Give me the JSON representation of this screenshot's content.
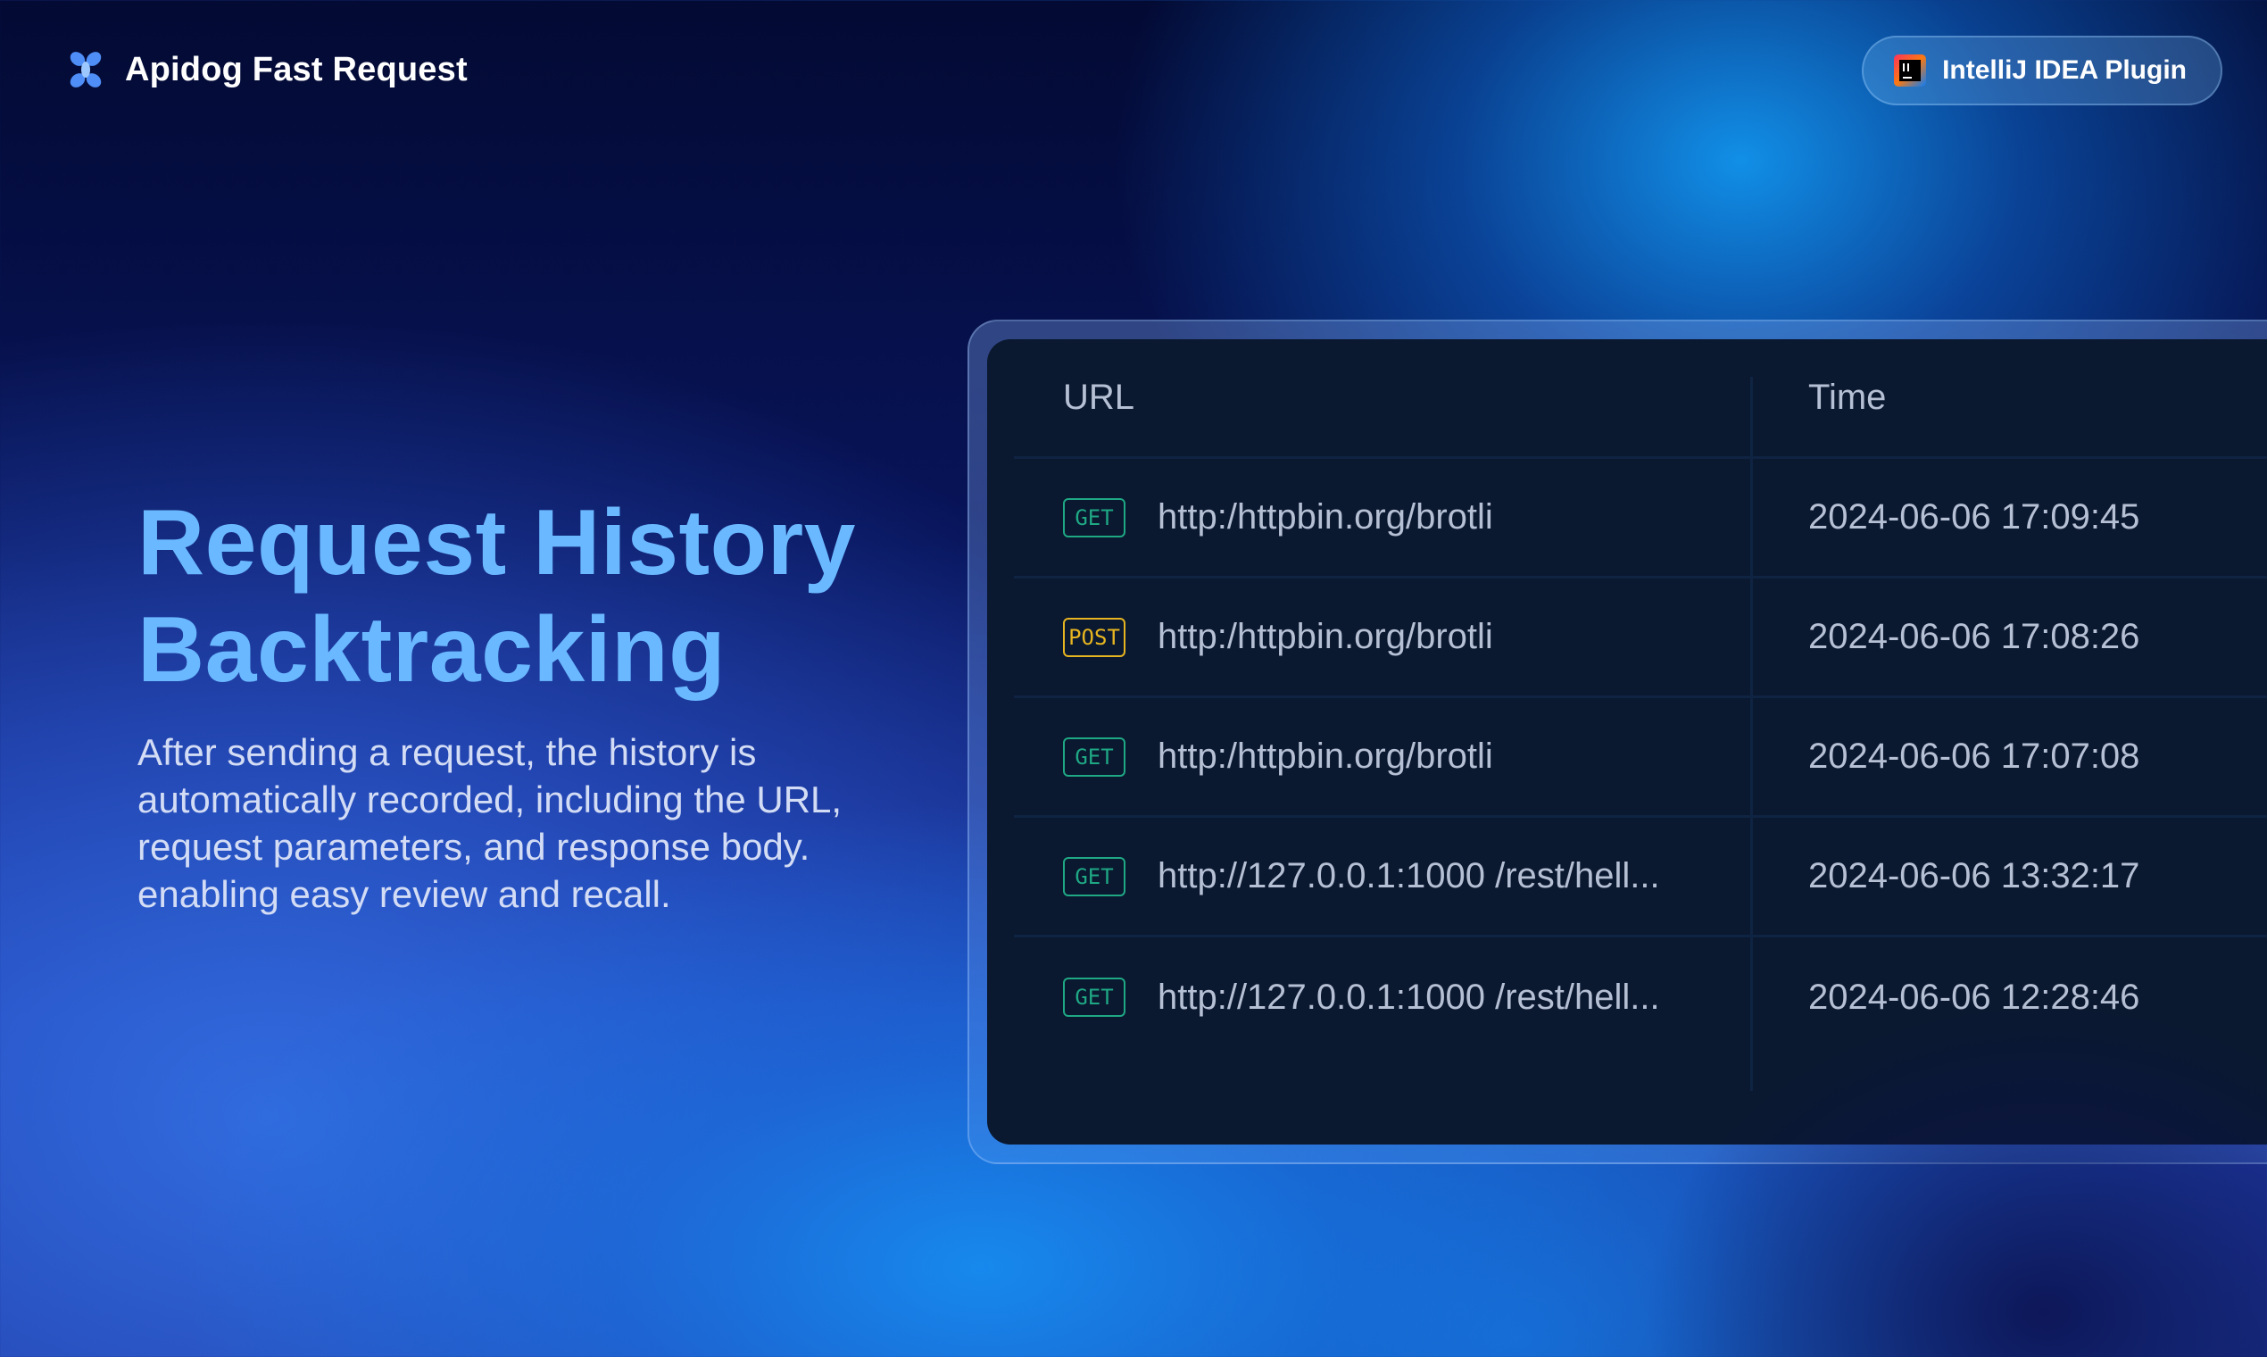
{
  "header": {
    "brand_name": "Apidog Fast Request",
    "plugin_label": "IntelliJ IDEA Plugin"
  },
  "hero": {
    "title_line1": "Request History",
    "title_line2": "Backtracking",
    "description": "After sending a request, the history is automatically recorded, including the URL, request parameters, and response body. enabling easy review and recall."
  },
  "table": {
    "columns": [
      "URL",
      "Time"
    ],
    "rows": [
      {
        "method": "GET",
        "url": "http:/httpbin.org/brotli",
        "time": "2024-06-06 17:09:45"
      },
      {
        "method": "POST",
        "url": "http:/httpbin.org/brotli",
        "time": "2024-06-06 17:08:26"
      },
      {
        "method": "GET",
        "url": "http:/httpbin.org/brotli",
        "time": "2024-06-06 17:07:08"
      },
      {
        "method": "GET",
        "url": "http://127.0.0.1:1000 /rest/hell...",
        "time": "2024-06-06 13:32:17"
      },
      {
        "method": "GET",
        "url": "http://127.0.0.1:1000 /rest/hell...",
        "time": "2024-06-06 12:28:46"
      }
    ]
  },
  "colors": {
    "accent_title": "#6ab8ff",
    "get_method": "#1fa884",
    "post_method": "#e6b520",
    "table_bg": "#0a1830"
  },
  "icons": {
    "brand": "apidog-logo-icon",
    "plugin": "intellij-idea-icon"
  }
}
